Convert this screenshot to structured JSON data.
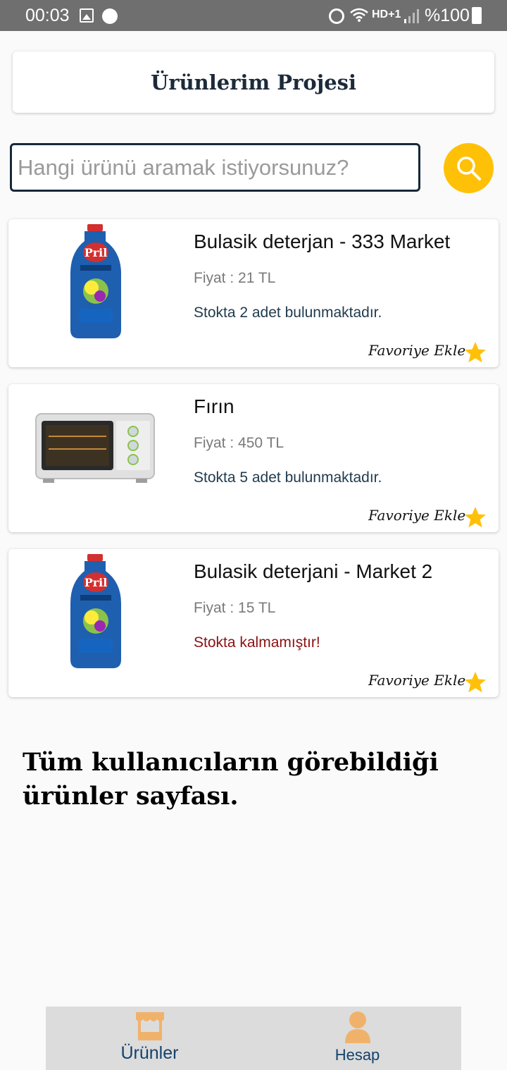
{
  "status_bar": {
    "time": "00:03",
    "network_label": "HD+1",
    "battery_text": "%100",
    "icons": [
      "image-icon",
      "sync-icon",
      "alarm-icon",
      "wifi-icon",
      "signal-icon",
      "battery-icon"
    ]
  },
  "header": {
    "title": "Ürünlerim Projesi"
  },
  "search": {
    "placeholder": "Hangi ürünü aramak istiyorsunuz?",
    "value": "",
    "icon": "search-icon",
    "accent_color": "#ffc107"
  },
  "products": [
    {
      "name": "Bulasik deterjan - 333 Market",
      "price": "Fiyat : 21 TL",
      "stock": "Stokta 2 adet bulunmaktadır.",
      "in_stock": true,
      "favorite_label": "Favoriye Ekle",
      "image": "detergent-bottle"
    },
    {
      "name": "Fırın",
      "price": "Fiyat : 450 TL",
      "stock": "Stokta 5 adet bulunmaktadır.",
      "in_stock": true,
      "favorite_label": "Favoriye Ekle",
      "image": "oven"
    },
    {
      "name": "Bulasik deterjani - Market 2",
      "price": "Fiyat : 15 TL",
      "stock": "Stokta kalmamıştır!",
      "in_stock": false,
      "favorite_label": "Favoriye Ekle",
      "image": "detergent-bottle"
    }
  ],
  "description": "Tüm kullanıcıların görebildiği ürünler sayfası.",
  "colors": {
    "out_of_stock": "#8b1111",
    "in_stock": "#1f3a4d",
    "star": "#ffc107",
    "nav_accent": "#f0b26b"
  },
  "bottom_nav": {
    "items": [
      {
        "label": "Ürünler",
        "icon": "market-stall-icon"
      },
      {
        "label": "Hesap",
        "icon": "user-icon"
      }
    ]
  }
}
